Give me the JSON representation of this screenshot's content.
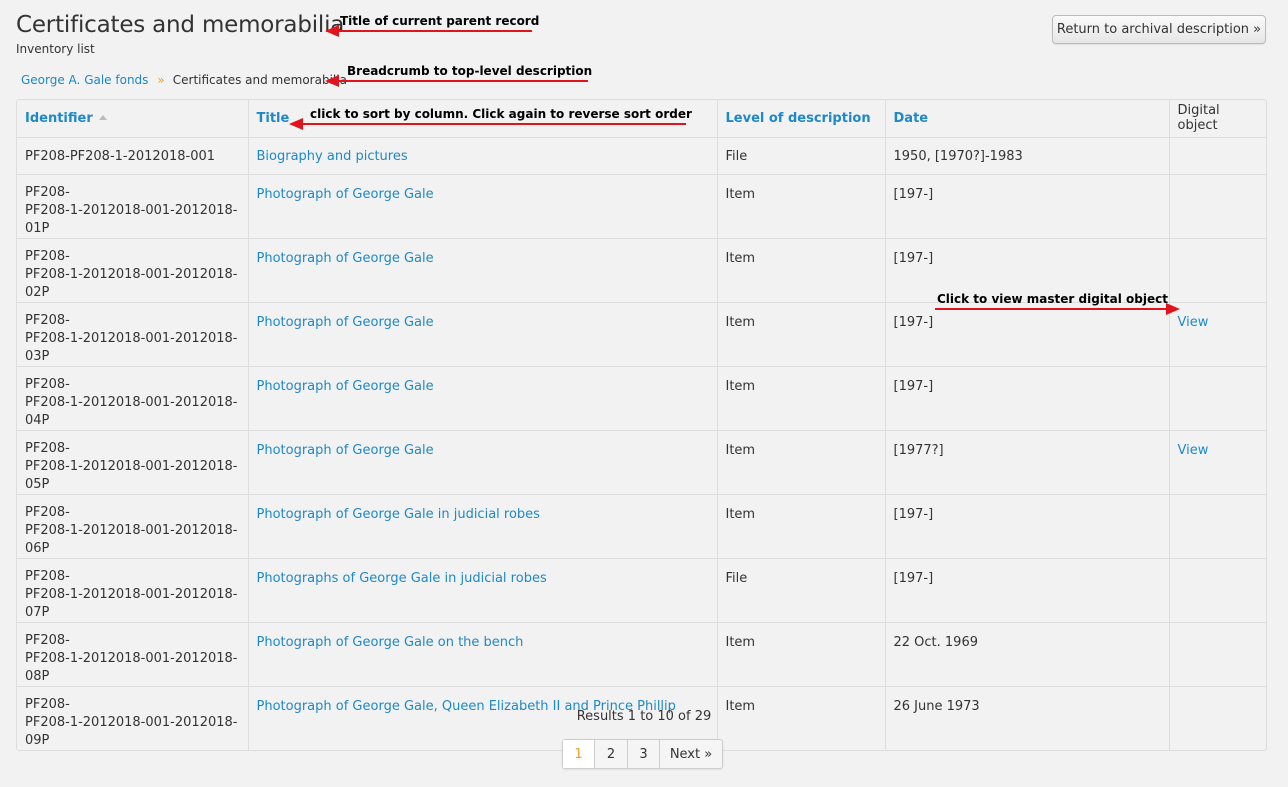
{
  "header": {
    "title": "Certificates and memorabilia",
    "subtitle": "Inventory list",
    "return_button": "Return to archival description »"
  },
  "breadcrumb": {
    "parent": "George A. Gale fonds",
    "separator": "»",
    "current": "Certificates and memorabilia"
  },
  "table": {
    "columns": [
      "Identifier",
      "Title",
      "Level of description",
      "Date",
      "Digital object"
    ],
    "rows": [
      {
        "id1": "PF208-PF208-1-2012018-001",
        "id2": "",
        "title": "Biography and pictures",
        "level": "File",
        "date": "1950, [1970?]-1983",
        "digital": ""
      },
      {
        "id1": "PF208-",
        "id2": "PF208-1-2012018-001-2012018-01P",
        "title": "Photograph of George Gale",
        "level": "Item",
        "date": "[197-]",
        "digital": ""
      },
      {
        "id1": "PF208-",
        "id2": "PF208-1-2012018-001-2012018-02P",
        "title": "Photograph of George Gale",
        "level": "Item",
        "date": "[197-]",
        "digital": ""
      },
      {
        "id1": "PF208-",
        "id2": "PF208-1-2012018-001-2012018-03P",
        "title": "Photograph of George Gale",
        "level": "Item",
        "date": "[197-]",
        "digital": "View"
      },
      {
        "id1": "PF208-",
        "id2": "PF208-1-2012018-001-2012018-04P",
        "title": "Photograph of George Gale",
        "level": "Item",
        "date": "[197-]",
        "digital": ""
      },
      {
        "id1": "PF208-",
        "id2": "PF208-1-2012018-001-2012018-05P",
        "title": "Photograph of George Gale",
        "level": "Item",
        "date": "[1977?]",
        "digital": "View"
      },
      {
        "id1": "PF208-",
        "id2": "PF208-1-2012018-001-2012018-06P",
        "title": "Photograph of George Gale in judicial robes",
        "level": "Item",
        "date": "[197-]",
        "digital": ""
      },
      {
        "id1": "PF208-",
        "id2": "PF208-1-2012018-001-2012018-07P",
        "title": "Photographs of George Gale in judicial robes",
        "level": "File",
        "date": "[197-]",
        "digital": ""
      },
      {
        "id1": "PF208-",
        "id2": "PF208-1-2012018-001-2012018-08P",
        "title": "Photograph of George Gale on the bench",
        "level": "Item",
        "date": "22 Oct. 1969",
        "digital": ""
      },
      {
        "id1": "PF208-",
        "id2": "PF208-1-2012018-001-2012018-09P",
        "title": "Photograph of George Gale, Queen Elizabeth II and Prince Phillip",
        "level": "Item",
        "date": "26 June 1973",
        "digital": ""
      }
    ]
  },
  "pagination": {
    "results_text": "Results 1 to 10 of 29",
    "pages": [
      "1",
      "2",
      "3"
    ],
    "next": "Next »",
    "current_page": "1"
  },
  "annotations": {
    "title_note": "Title of current parent record",
    "breadcrumb_note": "Breadcrumb to top-level description",
    "sort_note": "click to sort by column. Click again to reverse sort order",
    "digital_note": "Click to view master digital object"
  },
  "colors": {
    "link": "#1e88c8",
    "accent": "#f0a020",
    "annotation_arrow": "#e0141c",
    "background": "#f2f2f2"
  }
}
